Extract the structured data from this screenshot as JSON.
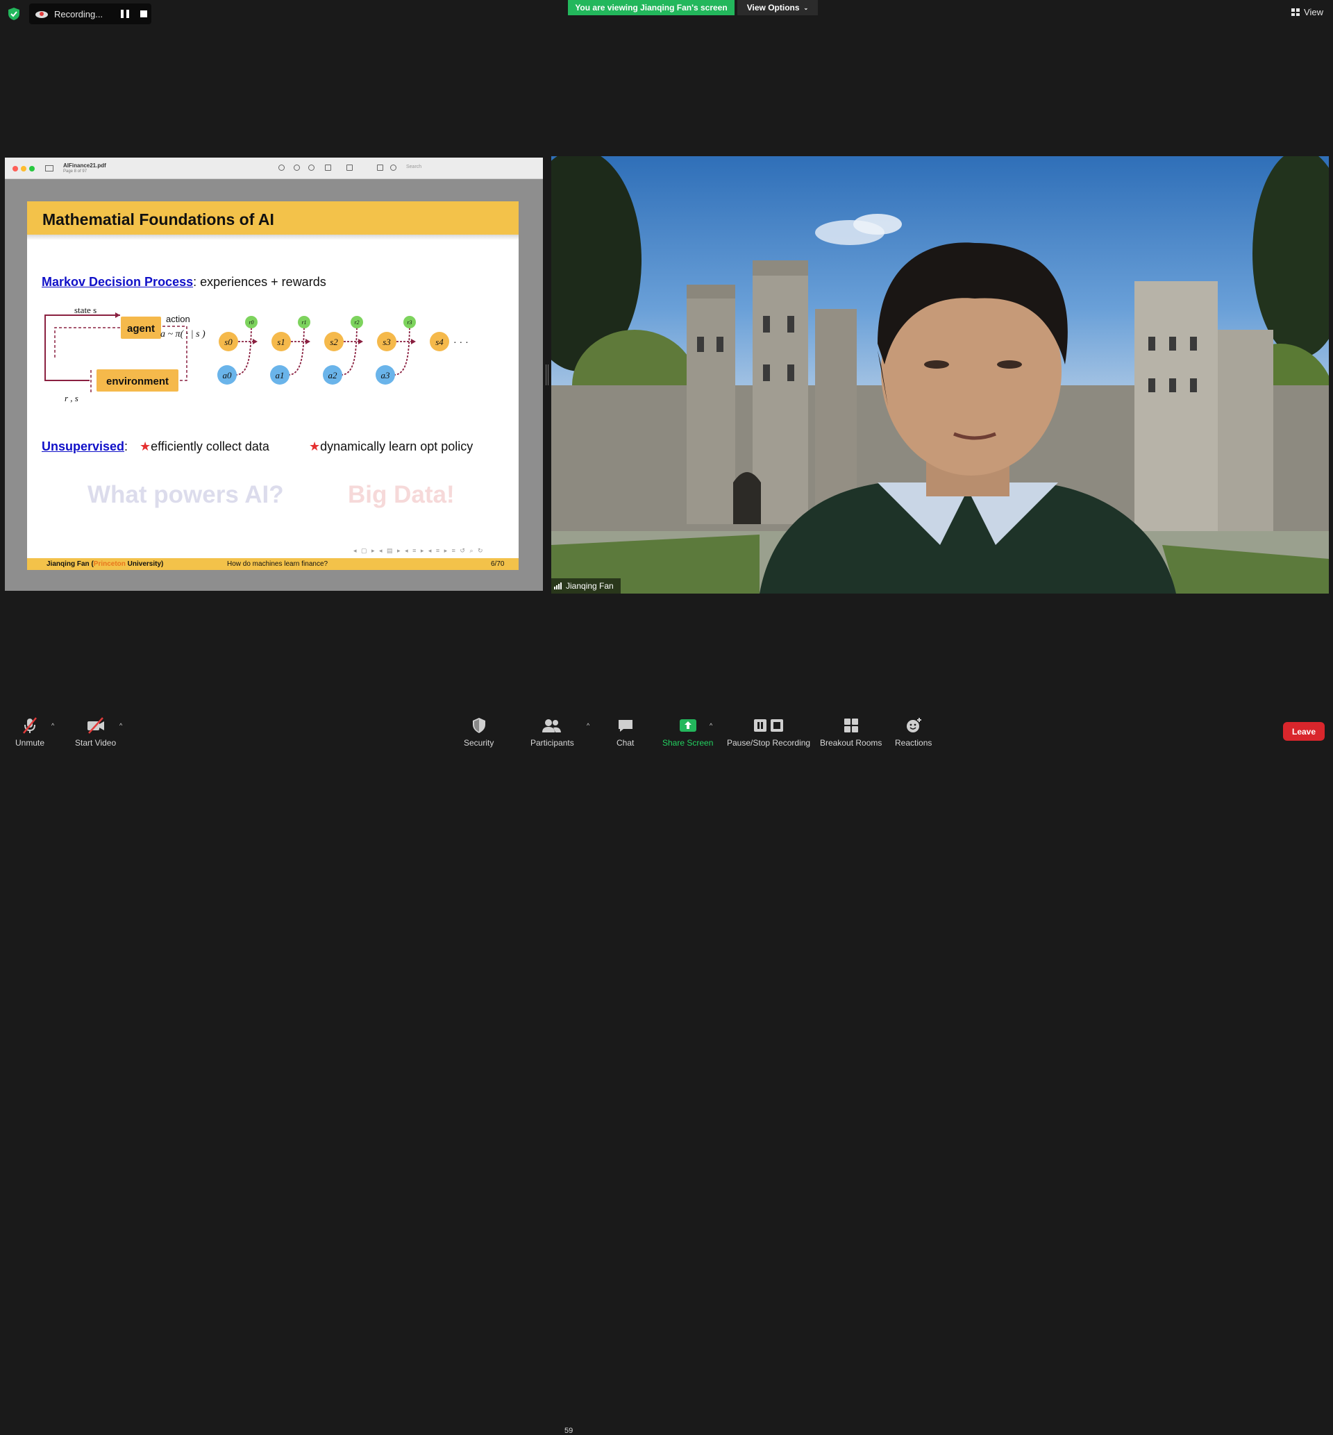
{
  "top_bar": {
    "recording_label": "Recording...",
    "viewing_banner": "You are viewing Jianqing Fan's screen",
    "view_options_label": "View Options",
    "view_label": "View"
  },
  "shared_screen": {
    "pdf_filename": "AIFinance21.pdf",
    "pdf_pages": "Page 8 of 97",
    "search_placeholder": "Search",
    "slide": {
      "title": "Mathematial Foundations of AI",
      "mdp_link": "Markov Decision Process",
      "mdp_text": ": experiences + rewards",
      "diagram": {
        "state_label": "state s",
        "agent_label": "agent",
        "action_label": "action",
        "policy_label": "a ~ π( · | s )",
        "environment_label": "environment",
        "reward_state_label": "r , s",
        "states": [
          "s0",
          "s1",
          "s2",
          "s3",
          "s4"
        ],
        "rewards": [
          "r0",
          "r1",
          "r2",
          "r3"
        ],
        "actions": [
          "a0",
          "a1",
          "a2",
          "a3"
        ],
        "ellipsis": "· · ·"
      },
      "unsupervised_link": "Unsupervised",
      "unsupervised_colon": ":",
      "bullet_1": "efficiently collect data",
      "bullet_2": "dynamically learn opt policy",
      "star": "★",
      "ghost_text_1": "What powers AI?",
      "ghost_text_2": "Big Data!",
      "footer_author": "Jianqing Fan (",
      "footer_uni": "Princeton",
      "footer_uni_rest": " University)",
      "footer_title": "How do machines learn finance?",
      "footer_page": "6/70"
    }
  },
  "video": {
    "participant_name": "Jianqing Fan"
  },
  "toolbar": {
    "unmute": "Unmute",
    "start_video": "Start Video",
    "security": "Security",
    "participants": "Participants",
    "participants_count": "59",
    "chat": "Chat",
    "share_screen": "Share Screen",
    "pause_stop_recording": "Pause/Stop Recording",
    "breakout_rooms": "Breakout Rooms",
    "reactions": "Reactions",
    "leave": "Leave"
  },
  "colors": {
    "share_green": "#23b75c",
    "leave_red": "#d9262c",
    "slide_yellow": "#f3c24a",
    "link_blue": "#1010c8"
  }
}
